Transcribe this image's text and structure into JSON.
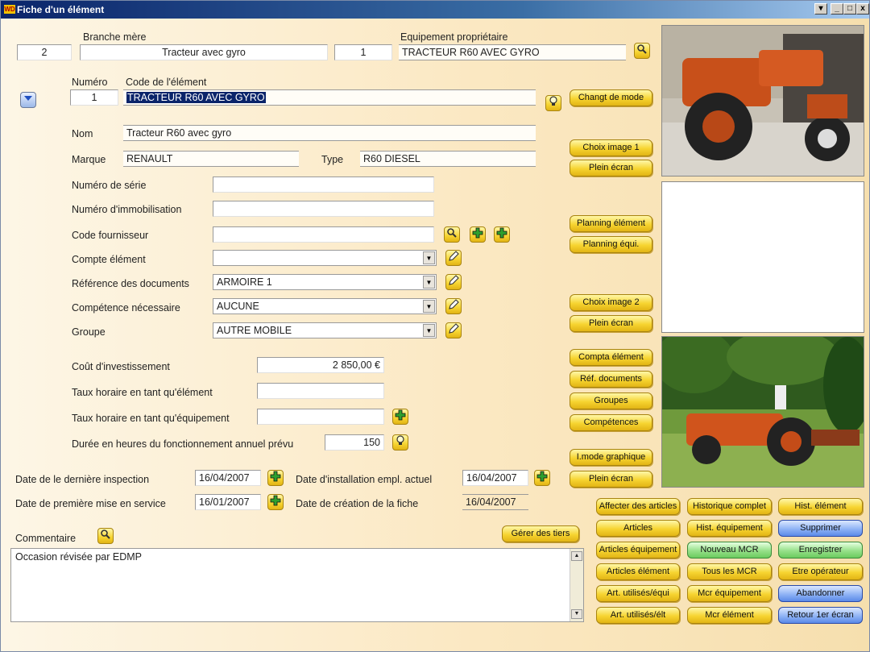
{
  "window": {
    "title": "Fiche d'un élément",
    "app_icon": "WD",
    "controls": [
      "▾",
      "_",
      "□",
      "x"
    ]
  },
  "header": {
    "branche_mere_label": "Branche mère",
    "branche_num": "2",
    "branche_value": "Tracteur avec gyro",
    "equip_label": "Equipement propriétaire",
    "equip_num": "1",
    "equip_value": "TRACTEUR R60 AVEC GYRO"
  },
  "element": {
    "numero_label": "Numéro",
    "numero": "1",
    "code_label": "Code de l'élément",
    "code": "TRACTEUR R60 AVEC GYRO",
    "nom_label": "Nom",
    "nom": "Tracteur R60 avec gyro",
    "marque_label": "Marque",
    "marque": "RENAULT",
    "type_label": "Type",
    "type": "R60 DIESEL",
    "serie_label": "Numéro de série",
    "serie": "",
    "immo_label": "Numéro d'immobilisation",
    "immo": "",
    "fournisseur_label": "Code fournisseur",
    "fournisseur": "",
    "compte_label": "Compte élément",
    "compte": "",
    "refdoc_label": "Référence des documents",
    "refdoc": "ARMOIRE 1",
    "competence_label": "Compétence nécessaire",
    "competence": "AUCUNE",
    "groupe_label": "Groupe",
    "groupe": "AUTRE MOBILE",
    "cout_label": "Coût d'investissement",
    "cout": "2 850,00 €",
    "taux_elem_label": "Taux horaire en tant qu'élément",
    "taux_elem": "",
    "taux_equip_label": "Taux horaire en tant qu'équipement",
    "taux_equip": "",
    "duree_label": "Durée en heures du fonctionnement annuel prévu",
    "duree": "150"
  },
  "dates": {
    "derniere_insp_label": "Date de le dernière inspection",
    "derniere_insp": "16/04/2007",
    "install_label": "Date d'installation empl. actuel",
    "install": "16/04/2007",
    "premiere_label": "Date de première mise en service",
    "premiere": "16/01/2007",
    "creation_label": "Date de création de la fiche",
    "creation": "16/04/2007"
  },
  "comment": {
    "label": "Commentaire",
    "text": "Occasion révisée par EDMP"
  },
  "side_buttons": {
    "changt_mode": "Changt de mode",
    "choix_image1": "Choix image 1",
    "plein_ecran1": "Plein écran",
    "planning_element": "Planning élément",
    "planning_equi": "Planning équi.",
    "choix_image2": "Choix image 2",
    "plein_ecran2": "Plein écran",
    "compta_element": "Compta élément",
    "ref_documents": "Réf. documents",
    "groupes": "Groupes",
    "competences": "Compétences",
    "mode_graphique": "I.mode graphique",
    "plein_ecran3": "Plein écran",
    "gerer_tiers": "Gérer des tiers"
  },
  "bottom_buttons": {
    "col1": [
      "Affecter des articles",
      "Articles",
      "Articles équipement",
      "Articles élément",
      "Art. utilisés/équi",
      "Art. utilisés/élt"
    ],
    "col2": [
      "Historique complet",
      "Hist. équipement",
      "Nouveau MCR",
      "Tous les MCR",
      "Mcr équipement",
      "Mcr élément"
    ],
    "col3": [
      "Hist. élément",
      "Supprimer",
      "Enregistrer",
      "Etre opérateur",
      "Abandonner",
      "Retour 1er écran"
    ]
  },
  "colors": {
    "yellow_button": "#f6d430",
    "green_button": "#96e08a",
    "blue_button": "#8fb3f5",
    "title_bar": "#0a246a",
    "background": "#fbe8c2"
  }
}
